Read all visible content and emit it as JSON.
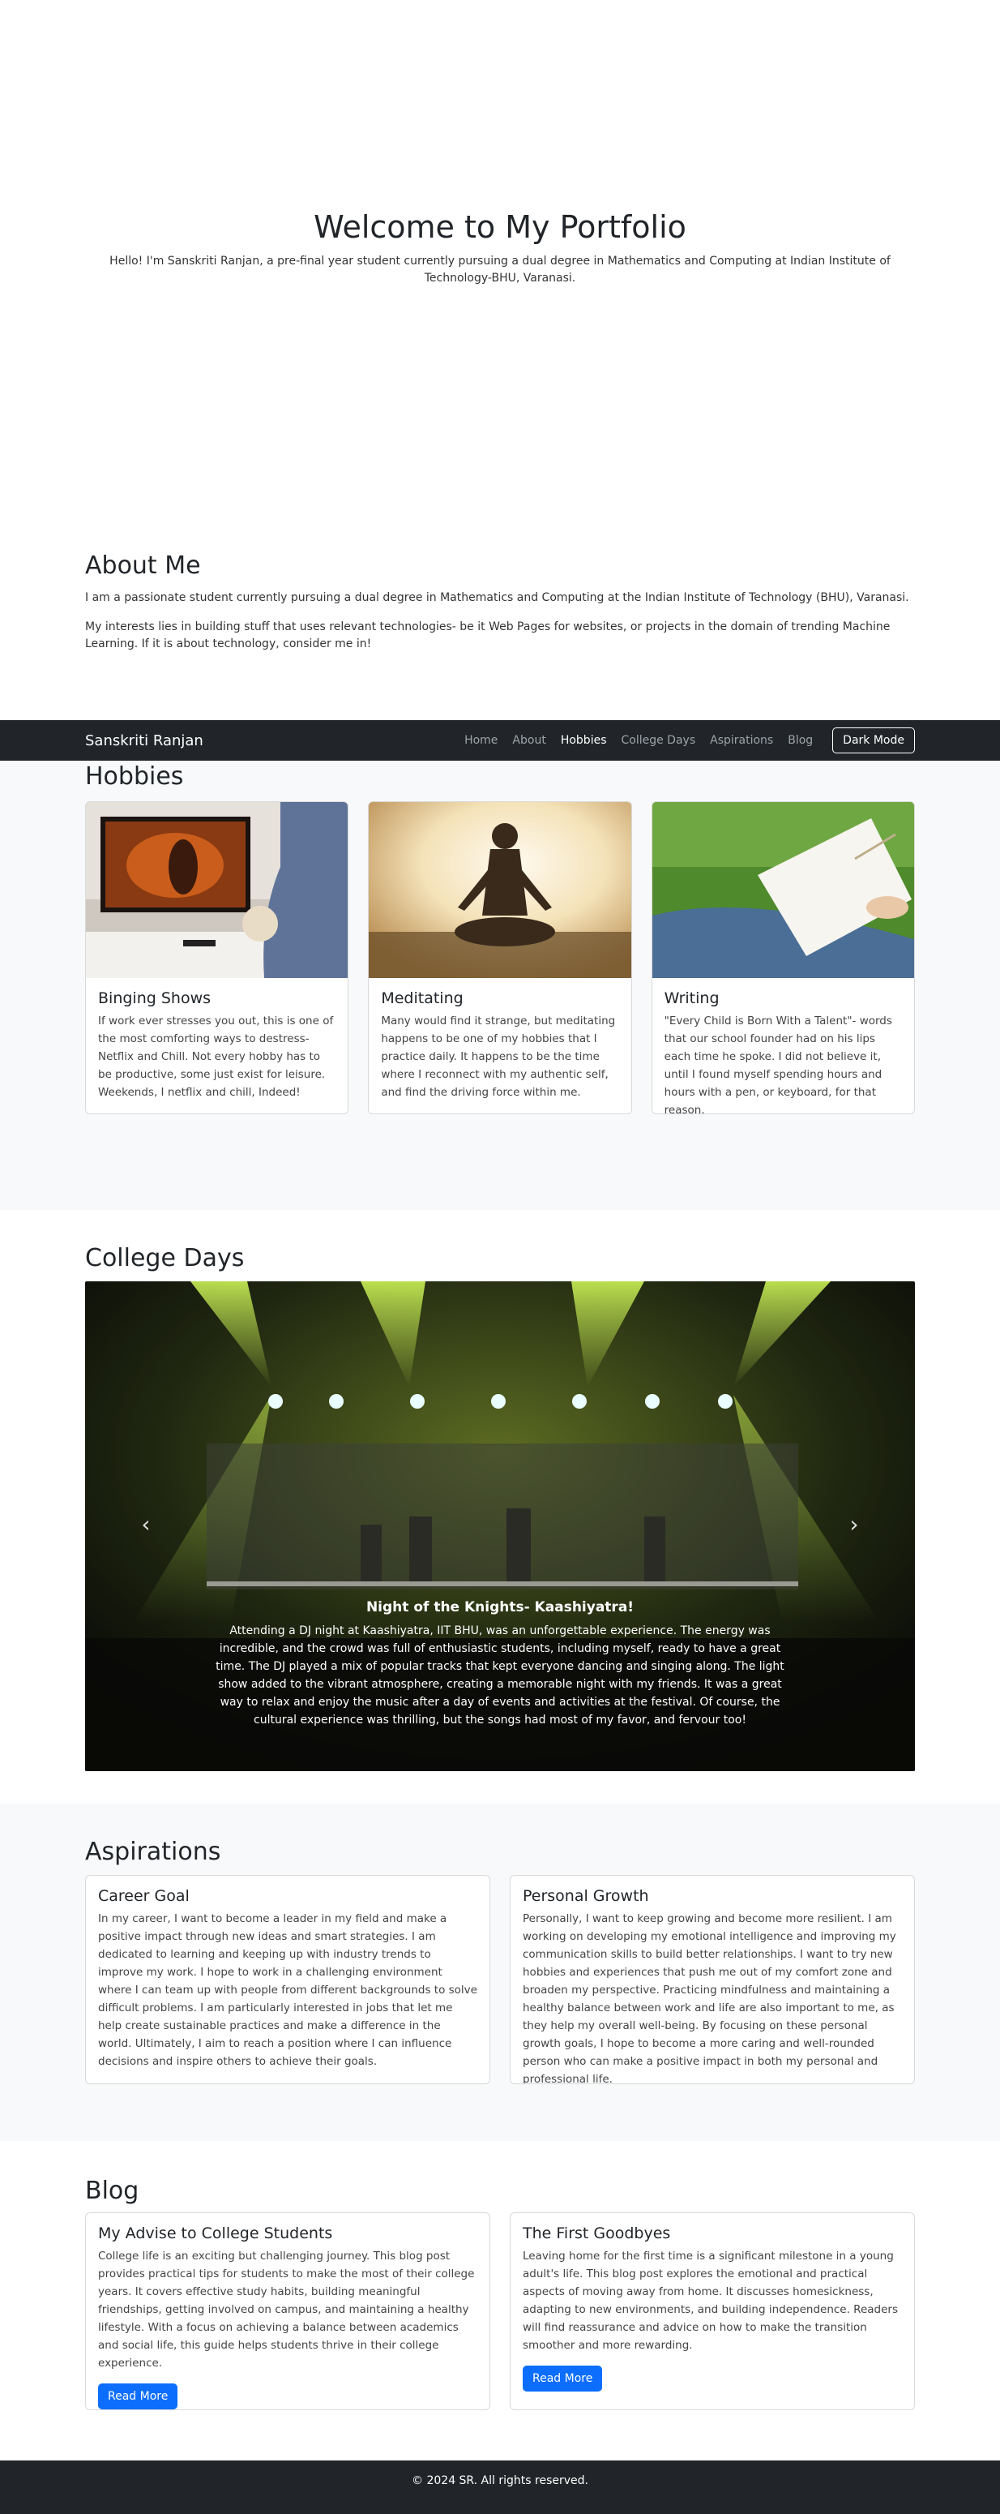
{
  "hero": {
    "title": "Welcome to My Portfolio",
    "subtitle": "Hello! I'm Sanskriti Ranjan, a pre-final year student currently pursuing a dual degree in Mathematics and Computing at Indian Institute of Technology-BHU, Varanasi."
  },
  "about": {
    "title": "About Me",
    "p1": "I am a passionate student currently pursuing a dual degree in Mathematics and Computing at the Indian Institute of Technology (BHU), Varanasi.",
    "p2": "My interests lies in building stuff that uses relevant technologies- be it Web Pages for websites, or projects in the domain of trending Machine Learning. If it is about technology, consider me in!"
  },
  "navbar": {
    "brand": "Sanskriti Ranjan",
    "links": [
      "Home",
      "About",
      "Hobbies",
      "College Days",
      "Aspirations",
      "Blog"
    ],
    "dark_mode": "Dark Mode"
  },
  "hobbies": {
    "title": "Hobbies",
    "cards": [
      {
        "title": "Binging Shows",
        "text": "If work ever stresses you out, this is one of the most comforting ways to destress- Netflix and Chill. Not every hobby has to be productive, some just exist for leisure. Weekends, I netflix and chill, Indeed!"
      },
      {
        "title": "Meditating",
        "text": "Many would find it strange, but meditating happens to be one of my hobbies that I practice daily. It happens to be the time where I reconnect with my authentic self, and find the driving force within me."
      },
      {
        "title": "Writing",
        "text": "\"Every Child is Born With a Talent\"- words that our school founder had on his lips each time he spoke. I did not believe it, until I found myself spending hours and hours with a pen, or keyboard, for that reason."
      }
    ]
  },
  "college": {
    "title": "College Days",
    "caption_title": "Night of the Knights- Kaashiyatra!",
    "caption_text": "Attending a DJ night at Kaashiyatra, IIT BHU, was an unforgettable experience. The energy was incredible, and the crowd was full of enthusiastic students, including myself, ready to have a great time. The DJ played a mix of popular tracks that kept everyone dancing and singing along. The light show added to the vibrant atmosphere, creating a memorable night with my friends. It was a great way to relax and enjoy the music after a day of events and activities at the festival. Of course, the cultural experience was thrilling, but the songs had most of my favor, and fervour too!"
  },
  "aspirations": {
    "title": "Aspirations",
    "cards": [
      {
        "title": "Career Goal",
        "text": "In my career, I want to become a leader in my field and make a positive impact through new ideas and smart strategies. I am dedicated to learning and keeping up with industry trends to improve my work. I hope to work in a challenging environment where I can team up with people from different backgrounds to solve difficult problems. I am particularly interested in jobs that let me help create sustainable practices and make a difference in the world. Ultimately, I aim to reach a position where I can influence decisions and inspire others to achieve their goals."
      },
      {
        "title": "Personal Growth",
        "text": "Personally, I want to keep growing and become more resilient. I am working on developing my emotional intelligence and improving my communication skills to build better relationships. I want to try new hobbies and experiences that push me out of my comfort zone and broaden my perspective. Practicing mindfulness and maintaining a healthy balance between work and life are also important to me, as they help my overall well-being. By focusing on these personal growth goals, I hope to become a more caring and well-rounded person who can make a positive impact in both my personal and professional life."
      }
    ]
  },
  "blog": {
    "title": "Blog",
    "cards": [
      {
        "title": "My Advise to College Students",
        "text": "College life is an exciting but challenging journey. This blog post provides practical tips for students to make the most of their college years. It covers effective study habits, building meaningful friendships, getting involved on campus, and maintaining a healthy lifestyle. With a focus on achieving a balance between academics and social life, this guide helps students thrive in their college experience.",
        "button": "Read More"
      },
      {
        "title": "The First Goodbyes",
        "text": "Leaving home for the first time is a significant milestone in a young adult's life. This blog post explores the emotional and practical aspects of moving away from home. It discusses homesickness, adapting to new environments, and building independence. Readers will find reassurance and advice on how to make the transition smoother and more rewarding.",
        "button": "Read More"
      }
    ]
  },
  "footer": {
    "text": "© 2024 SR. All rights reserved."
  }
}
